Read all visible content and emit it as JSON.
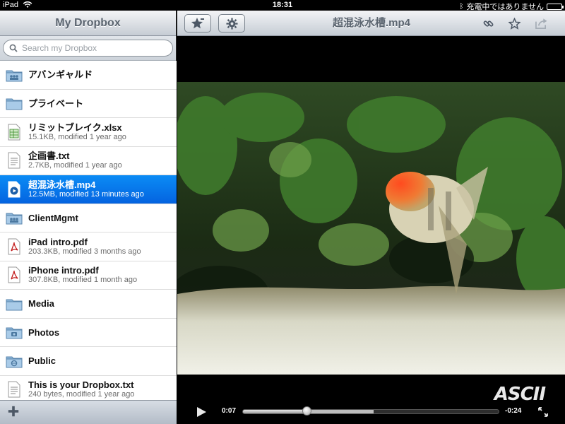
{
  "status_bar": {
    "device": "iPad",
    "time": "18:31",
    "charging_text": "充電中ではありません"
  },
  "sidebar": {
    "title": "My Dropbox",
    "search_placeholder": "Search my Dropbox",
    "items": [
      {
        "name": "アバンギャルド",
        "meta": "",
        "icon": "shared-folder-icon",
        "selected": false
      },
      {
        "name": "プライベート",
        "meta": "",
        "icon": "folder-icon",
        "selected": false
      },
      {
        "name": "リミットブレイク.xlsx",
        "meta": "15.1KB, modified 1 year ago",
        "icon": "spreadsheet-file-icon",
        "selected": false
      },
      {
        "name": "企画書.txt",
        "meta": "2.7KB, modified 1 year ago",
        "icon": "text-file-icon",
        "selected": false
      },
      {
        "name": "超混泳水槽.mp4",
        "meta": "12.5MB, modified 13 minutes ago",
        "icon": "video-file-icon",
        "selected": true
      },
      {
        "name": "ClientMgmt",
        "meta": "",
        "icon": "shared-folder-icon",
        "selected": false
      },
      {
        "name": "iPad intro.pdf",
        "meta": "203.3KB, modified 3 months ago",
        "icon": "pdf-file-icon",
        "selected": false
      },
      {
        "name": "iPhone intro.pdf",
        "meta": "307.8KB, modified 1 month ago",
        "icon": "pdf-file-icon",
        "selected": false
      },
      {
        "name": "Media",
        "meta": "",
        "icon": "folder-icon",
        "selected": false
      },
      {
        "name": "Photos",
        "meta": "",
        "icon": "photos-folder-icon",
        "selected": false
      },
      {
        "name": "Public",
        "meta": "",
        "icon": "public-folder-icon",
        "selected": false
      },
      {
        "name": "This is your Dropbox.txt",
        "meta": "240 bytes, modified 1 year ago",
        "icon": "text-file-icon",
        "selected": false
      }
    ]
  },
  "viewer": {
    "title": "超混泳水槽.mp4",
    "watermark": "ASCII",
    "time_elapsed": "0:07",
    "time_remaining": "-0:24",
    "progress": 0.25,
    "buffered": 0.51
  },
  "colors": {
    "selection": "#0a78ea",
    "toolbar_text": "#5b6570"
  }
}
